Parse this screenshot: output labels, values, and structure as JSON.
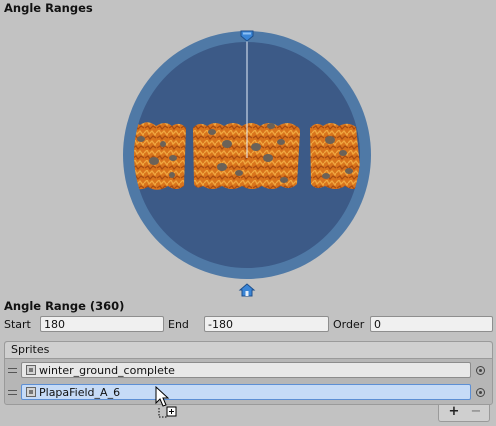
{
  "angle_ranges": {
    "title": "Angle Ranges",
    "handle_icon": "diamond-handle-icon",
    "bottom_marker_icon": "house-marker-icon",
    "colors": {
      "ring": "#4f79a6",
      "disc": "#3c5a87",
      "handle": "#3a85d6"
    }
  },
  "angle_range": {
    "title": "Angle Range (360)",
    "start_label": "Start",
    "start_value": "180",
    "end_label": "End",
    "end_value": "-180",
    "order_label": "Order",
    "order_value": "0"
  },
  "sprites": {
    "header": "Sprites",
    "items": [
      {
        "label": "winter_ground_complete",
        "selected": false
      },
      {
        "label": "PlapaField_A_6",
        "selected": true
      }
    ],
    "add_label": "+",
    "remove_label": "−"
  }
}
